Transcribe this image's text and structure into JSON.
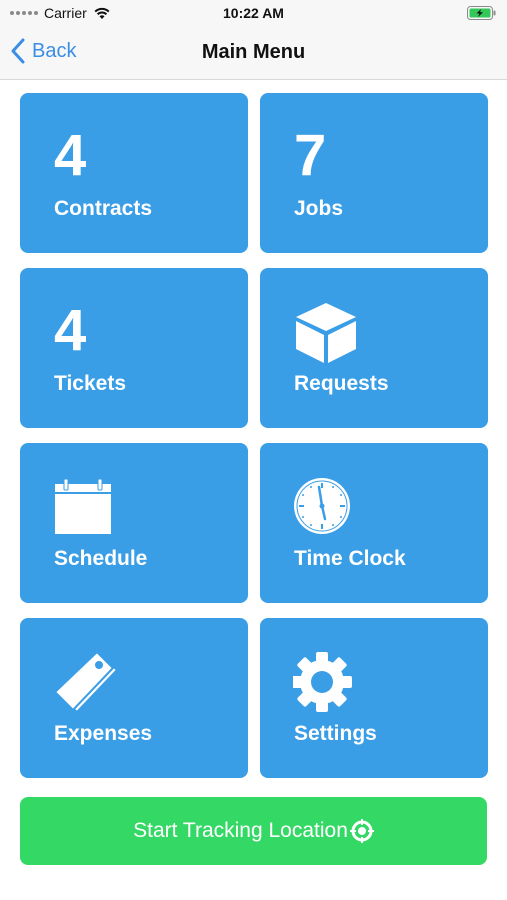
{
  "status_bar": {
    "carrier": "Carrier",
    "time": "10:22 AM"
  },
  "nav": {
    "back_label": "Back",
    "title": "Main Menu"
  },
  "tiles": [
    {
      "label": "Contracts",
      "count": "4"
    },
    {
      "label": "Jobs",
      "count": "7"
    },
    {
      "label": "Tickets",
      "count": "4"
    },
    {
      "label": "Requests",
      "icon": "cube-icon"
    },
    {
      "label": "Schedule",
      "icon": "calendar-icon"
    },
    {
      "label": "Time Clock",
      "icon": "clock-icon"
    },
    {
      "label": "Expenses",
      "icon": "tag-icon"
    },
    {
      "label": "Settings",
      "icon": "gear-icon"
    }
  ],
  "tracking_button": {
    "label": "Start Tracking Location",
    "icon": "location-target-icon"
  },
  "colors": {
    "tile_blue": "#3a9ee6",
    "button_green": "#34d865",
    "ios_blue": "#3a8ee6"
  }
}
